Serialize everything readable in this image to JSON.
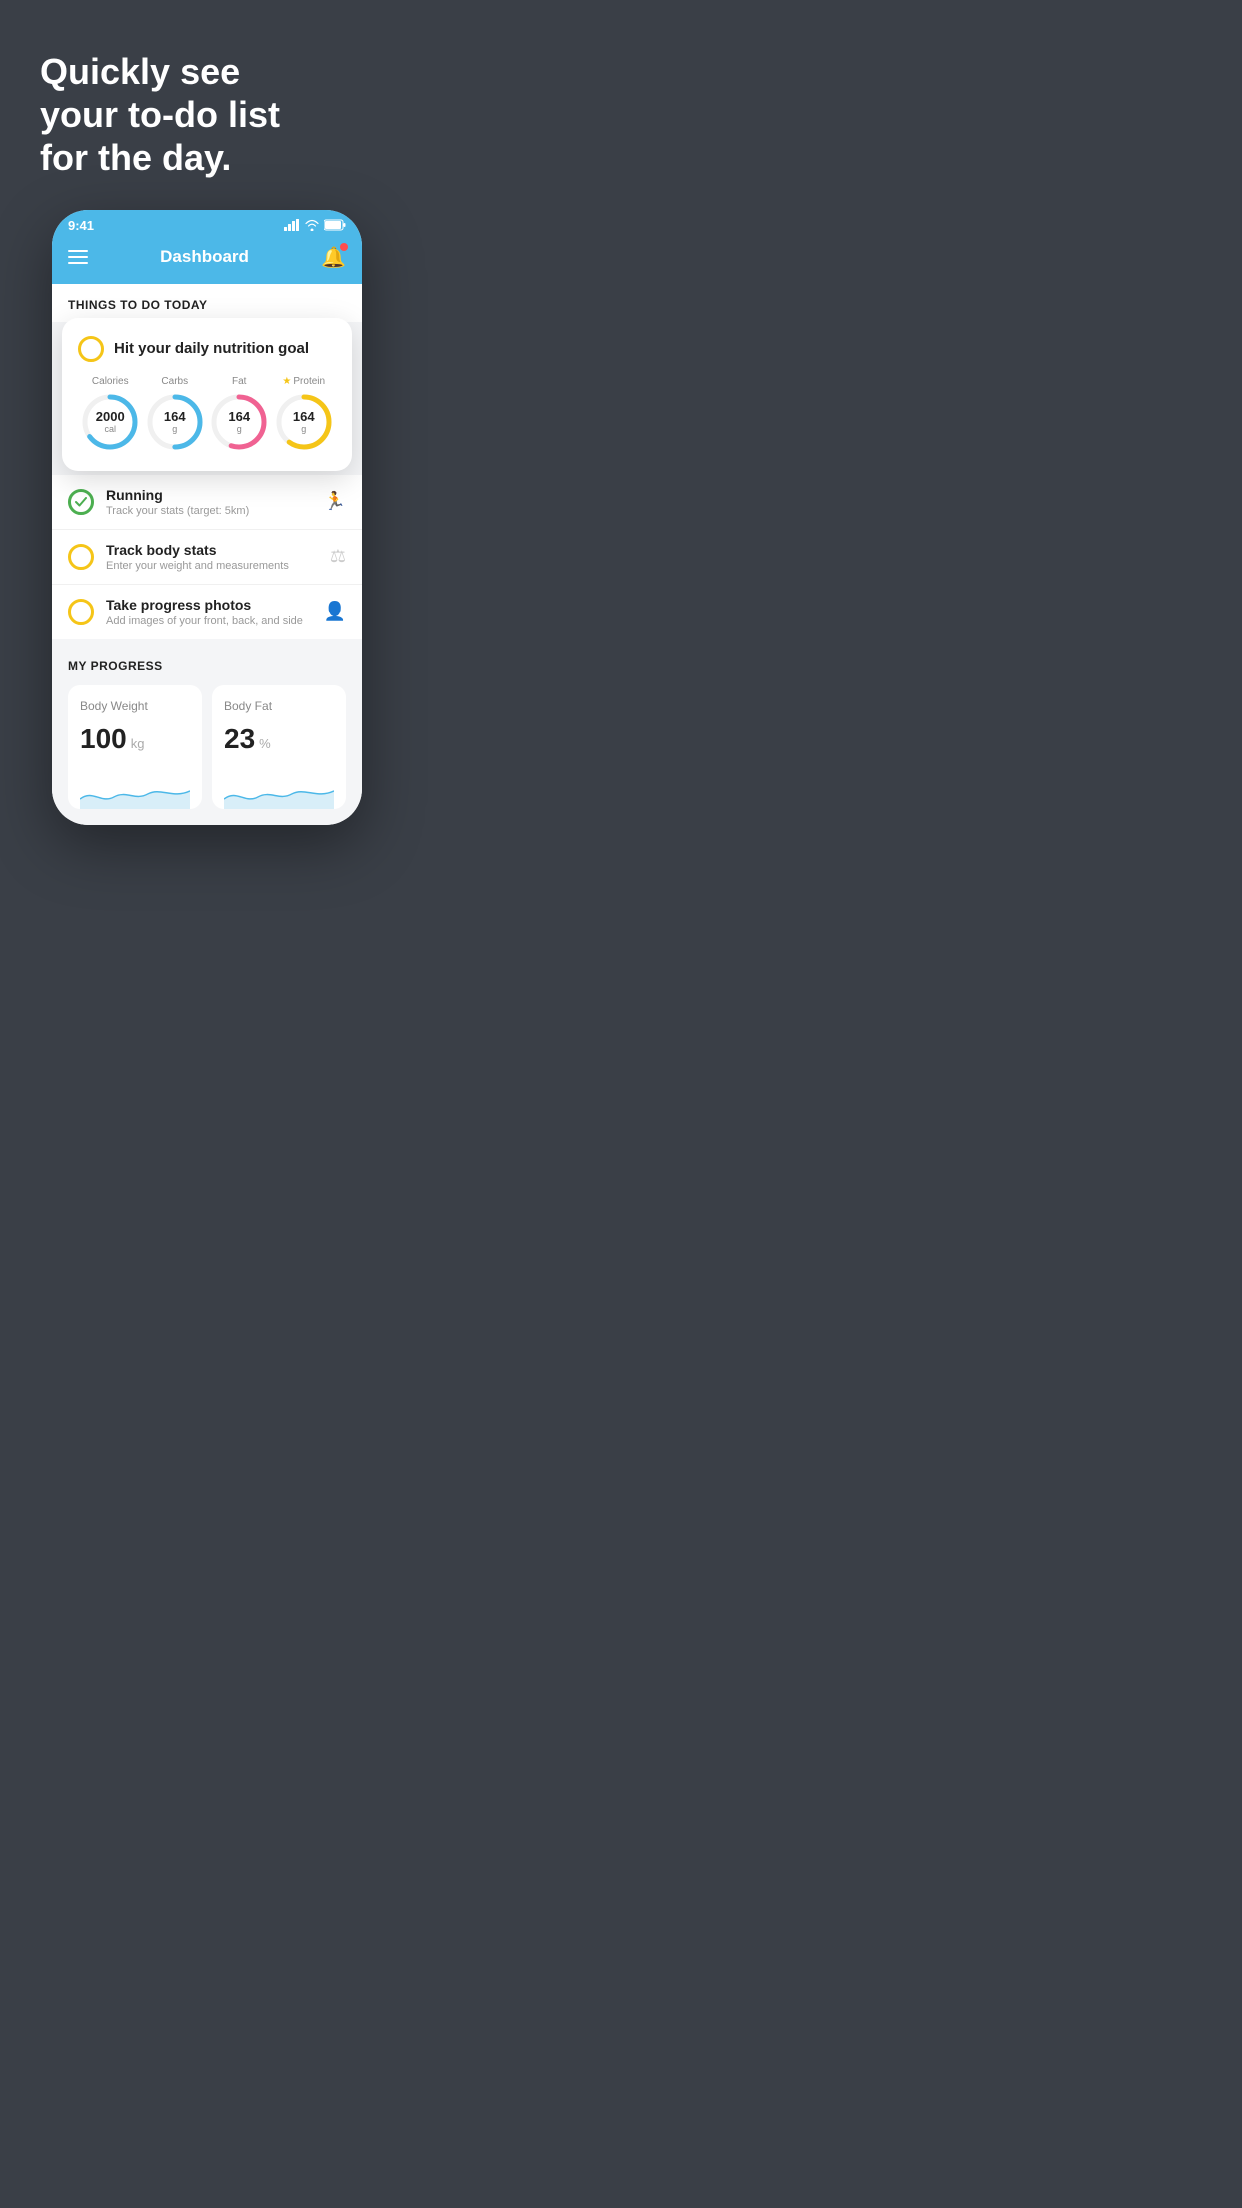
{
  "hero": {
    "line1": "Quickly see",
    "line2": "your to-do list",
    "line3": "for the day."
  },
  "statusBar": {
    "time": "9:41"
  },
  "header": {
    "title": "Dashboard"
  },
  "thingsToDo": {
    "sectionLabel": "THINGS TO DO TODAY"
  },
  "nutritionCard": {
    "title": "Hit your daily nutrition goal",
    "items": [
      {
        "label": "Calories",
        "value": "2000",
        "unit": "cal",
        "color": "#4cb8e8",
        "pct": 65,
        "star": false
      },
      {
        "label": "Carbs",
        "value": "164",
        "unit": "g",
        "color": "#4cb8e8",
        "pct": 50,
        "star": false
      },
      {
        "label": "Fat",
        "value": "164",
        "unit": "g",
        "color": "#f06292",
        "pct": 55,
        "star": false
      },
      {
        "label": "Protein",
        "value": "164",
        "unit": "g",
        "color": "#f5c518",
        "pct": 60,
        "star": true
      }
    ]
  },
  "listItems": [
    {
      "title": "Running",
      "subtitle": "Track your stats (target: 5km)",
      "icon": "🏃",
      "checked": true,
      "checkColor": "#4caf50"
    },
    {
      "title": "Track body stats",
      "subtitle": "Enter your weight and measurements",
      "icon": "⚖",
      "checked": false,
      "checkColor": "#f5c518"
    },
    {
      "title": "Take progress photos",
      "subtitle": "Add images of your front, back, and side",
      "icon": "👤",
      "checked": false,
      "checkColor": "#f5c518"
    }
  ],
  "progress": {
    "sectionLabel": "MY PROGRESS",
    "cards": [
      {
        "title": "Body Weight",
        "value": "100",
        "unit": "kg"
      },
      {
        "title": "Body Fat",
        "value": "23",
        "unit": "%"
      }
    ]
  }
}
